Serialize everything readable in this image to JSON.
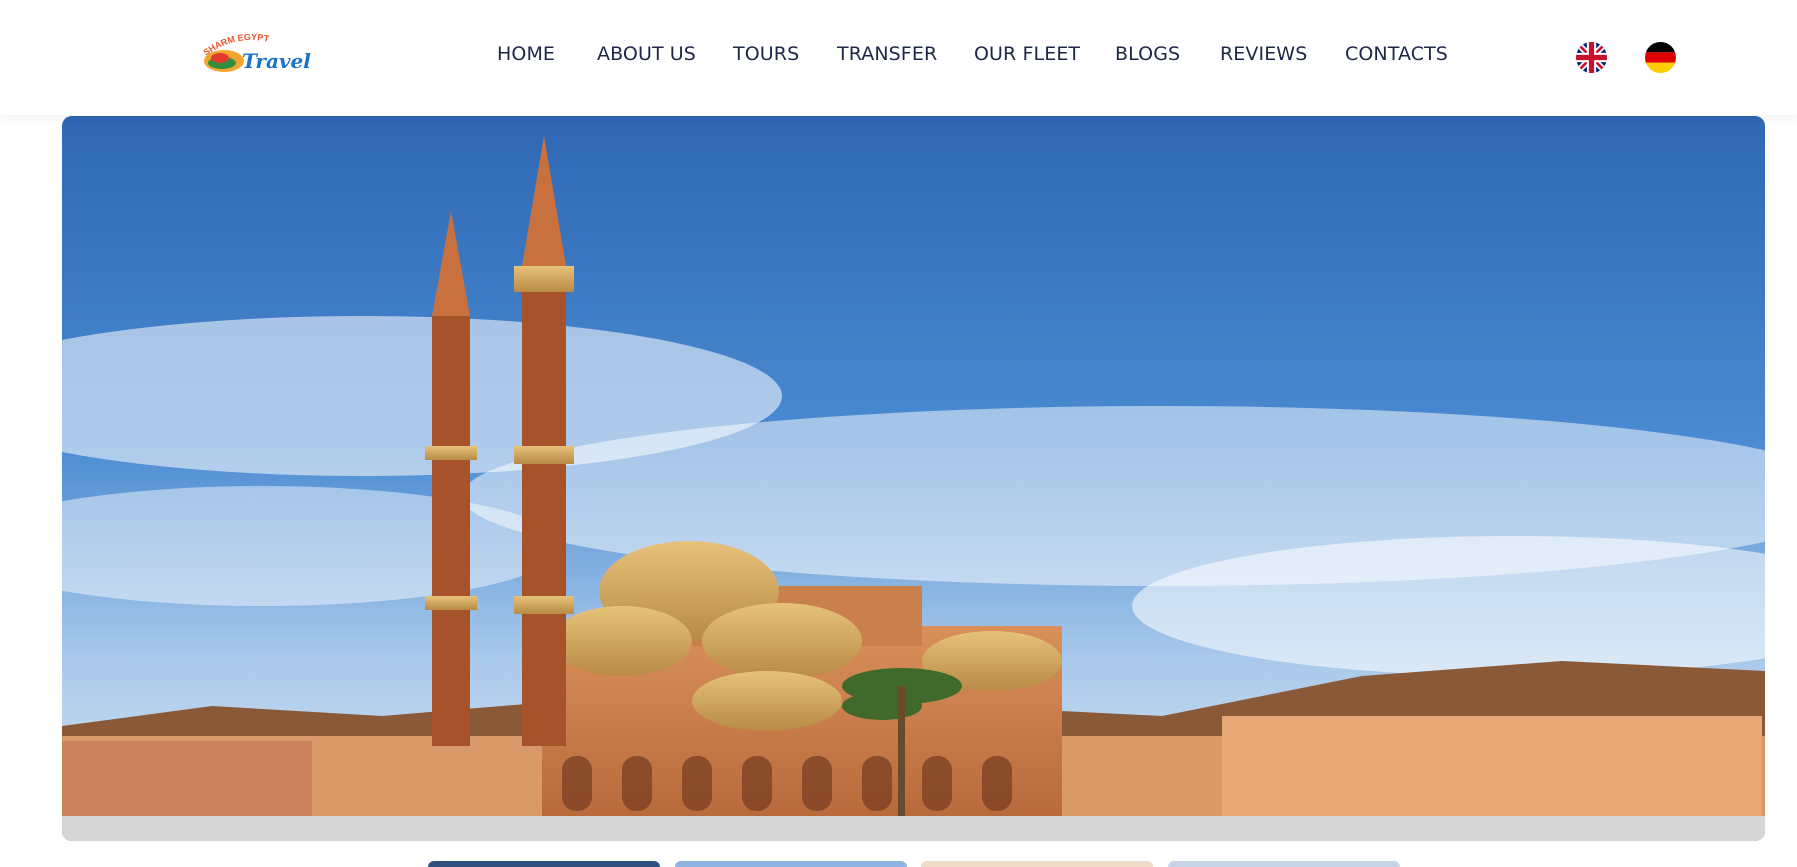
{
  "site": {
    "logo": {
      "icon": "sharm-egypt-travel-logo",
      "alt": "SHARM EGYPT Travel",
      "top_text": "SHARM EGYPT",
      "script_text": "Travel"
    }
  },
  "nav": {
    "items": [
      {
        "label": "HOME"
      },
      {
        "label": "ABOUT US"
      },
      {
        "label": "TOURS"
      },
      {
        "label": "TRANSFER"
      },
      {
        "label": "OUR FLEET"
      },
      {
        "label": "BLOGS"
      },
      {
        "label": "REVIEWS"
      },
      {
        "label": "CONTACTS"
      }
    ]
  },
  "languages": [
    {
      "icon": "uk-flag-icon",
      "code": "English"
    },
    {
      "icon": "germany-flag-icon",
      "code": "German"
    }
  ],
  "hero": {
    "image": "mosque-with-minarets-under-blue-sky",
    "alt": "Al Sahaba Mosque, Sharm El Sheikh"
  },
  "gallery": {
    "thumbnails": [
      {
        "image": "thumbnail-blue"
      },
      {
        "image": "thumbnail-sky"
      },
      {
        "image": "thumbnail-sand"
      },
      {
        "image": "thumbnail-light"
      }
    ]
  },
  "colors": {
    "nav_text": "#1d2747",
    "background": "#ffffff",
    "sky": "#3a78c5"
  }
}
